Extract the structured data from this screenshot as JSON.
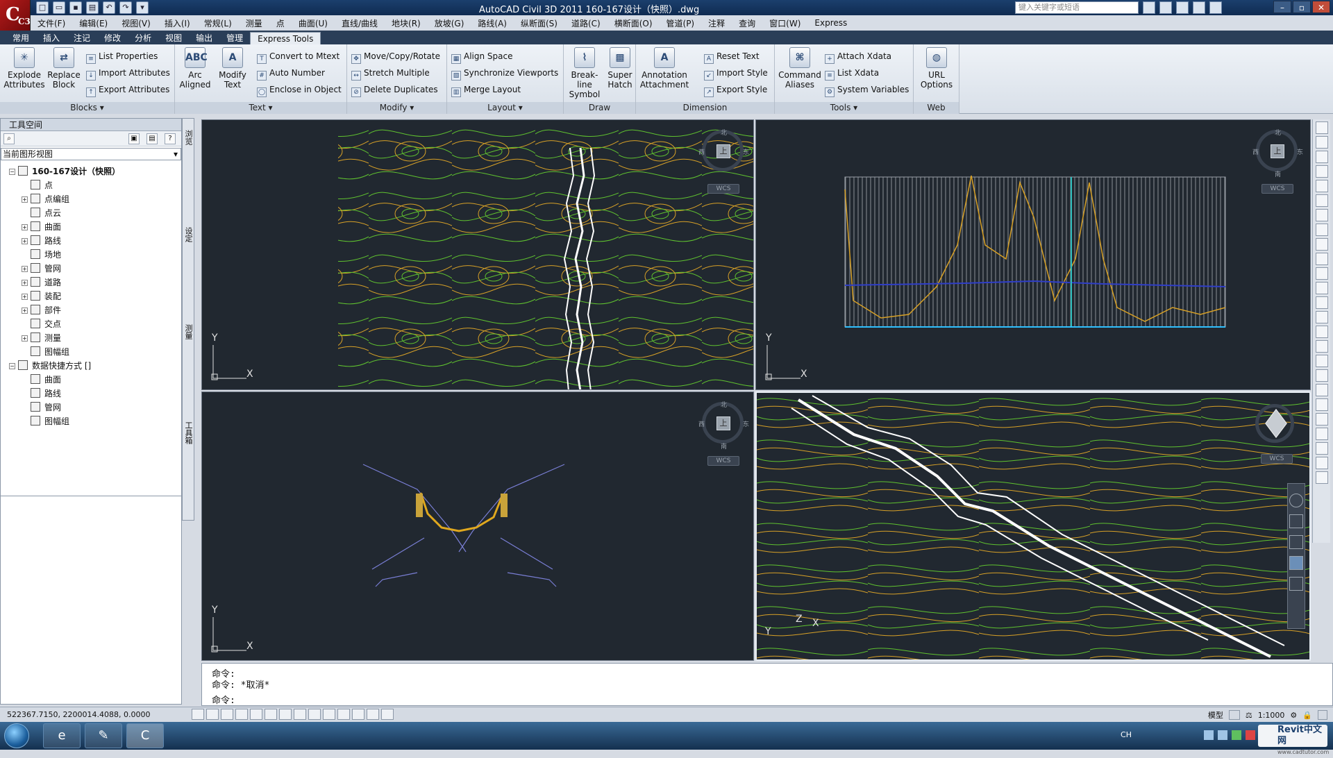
{
  "window": {
    "title": "AutoCAD Civil 3D 2011    160-167设计（快照）.dwg",
    "search_placeholder": "键入关键字或短语",
    "app_logo": "C3D"
  },
  "menu": [
    "文件(F)",
    "编辑(E)",
    "视图(V)",
    "插入(I)",
    "常规(L)",
    "测量",
    "点",
    "曲面(U)",
    "直线/曲线",
    "地块(R)",
    "放坡(G)",
    "路线(A)",
    "纵断面(S)",
    "道路(C)",
    "横断面(O)",
    "管道(P)",
    "注释",
    "查询",
    "窗口(W)",
    "Express"
  ],
  "ribbon_tabs": [
    "常用",
    "插入",
    "注记",
    "修改",
    "分析",
    "视图",
    "输出",
    "管理",
    "Express Tools"
  ],
  "ribbon_active_tab": "Express Tools",
  "ribbon": {
    "blocks": {
      "title": "Blocks",
      "big": [
        "Explode Attributes",
        "Replace Block"
      ],
      "small": [
        "List Properties",
        "Import Attributes",
        "Export Attributes"
      ]
    },
    "text": {
      "title": "Text",
      "big": [
        "Arc Aligned",
        "Modify Text"
      ],
      "small": [
        "Convert to Mtext",
        "Auto Number",
        "Enclose in Object"
      ]
    },
    "modify": {
      "title": "Modify",
      "small": [
        "Move/Copy/Rotate",
        "Stretch Multiple",
        "Delete Duplicates"
      ]
    },
    "layout": {
      "title": "Layout",
      "small": [
        "Align Space",
        "Synchronize Viewports",
        "Merge Layout"
      ]
    },
    "draw": {
      "title": "Draw",
      "big": [
        "Break-line Symbol",
        "Super Hatch"
      ]
    },
    "dimension": {
      "title": "Dimension",
      "big": [
        "Annotation Attachment"
      ],
      "small": [
        "Reset Text",
        "Import Style",
        "Export Style"
      ]
    },
    "tools": {
      "title": "Tools",
      "big": [
        "Command Aliases"
      ],
      "small": [
        "Attach Xdata",
        "List Xdata",
        "System Variables"
      ]
    },
    "web": {
      "title": "Web",
      "big": [
        "URL Options"
      ]
    }
  },
  "toolspace": {
    "header": "工具空间",
    "view_select": "当前图形视图",
    "tree": [
      {
        "label": "160-167设计（快照）",
        "level": 0,
        "exp": "−",
        "bold": true
      },
      {
        "label": "点",
        "level": 1,
        "exp": ""
      },
      {
        "label": "点编组",
        "level": 1,
        "exp": "+"
      },
      {
        "label": "点云",
        "level": 1,
        "exp": ""
      },
      {
        "label": "曲面",
        "level": 1,
        "exp": "+"
      },
      {
        "label": "路线",
        "level": 1,
        "exp": "+"
      },
      {
        "label": "场地",
        "level": 1,
        "exp": ""
      },
      {
        "label": "管网",
        "level": 1,
        "exp": "+"
      },
      {
        "label": "道路",
        "level": 1,
        "exp": "+"
      },
      {
        "label": "装配",
        "level": 1,
        "exp": "+"
      },
      {
        "label": "部件",
        "level": 1,
        "exp": "+"
      },
      {
        "label": "交点",
        "level": 1,
        "exp": ""
      },
      {
        "label": "测量",
        "level": 1,
        "exp": "+"
      },
      {
        "label": "图幅组",
        "level": 1,
        "exp": ""
      },
      {
        "label": "数据快捷方式 []",
        "level": 0,
        "exp": "−"
      },
      {
        "label": "曲面",
        "level": 1,
        "exp": ""
      },
      {
        "label": "路线",
        "level": 1,
        "exp": ""
      },
      {
        "label": "管网",
        "level": 1,
        "exp": ""
      },
      {
        "label": "图幅组",
        "level": 1,
        "exp": ""
      }
    ],
    "side_tabs": [
      "浏览",
      "设定",
      "测量",
      "工具箱"
    ]
  },
  "viewports": {
    "navcube_top": "上",
    "wcs_label": "WCS",
    "dir_n": "北",
    "dir_s": "南",
    "dir_w": "西",
    "dir_e": "东",
    "axis_x": "X",
    "axis_y": "Y",
    "axis_z": "Z"
  },
  "command": {
    "line1": "命令:",
    "line2": "命令: *取消*",
    "prompt": "命令:"
  },
  "status": {
    "coords": "522367.7150, 2200014.4088, 0.0000",
    "model": "模型",
    "scale": "1:1000"
  },
  "taskbar": {
    "tray_lang": "CH",
    "brand": "Revit中文网",
    "brand_sub": "www.cadtutor.com"
  },
  "colors": {
    "viewport_bg": "#212830",
    "contour_green": "#5fc22e",
    "contour_yellow": "#d8a126",
    "road_white": "#ffffff",
    "profile_blue": "#2f3ec8"
  }
}
